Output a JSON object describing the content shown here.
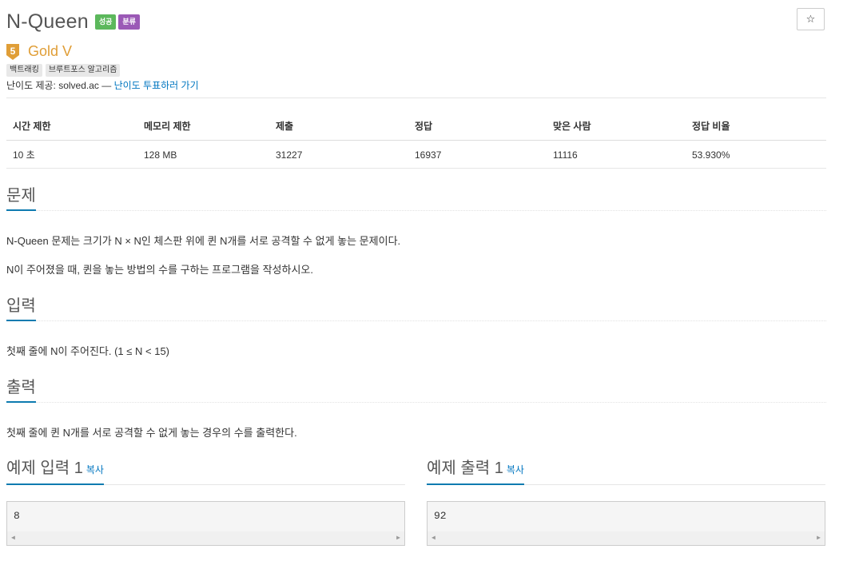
{
  "problem": {
    "title": "N-Queen",
    "badges": [
      "성공",
      "분류"
    ],
    "star": "☆",
    "tier_number": "5",
    "tier_name": "Gold V",
    "tags": [
      "백트래킹",
      "브루트포스 알고리즘"
    ],
    "provider_prefix": "난이도 제공: solved.ac — ",
    "provider_link": "난이도 투표하러 가기"
  },
  "info": {
    "headers": [
      "시간 제한",
      "메모리 제한",
      "제출",
      "정답",
      "맞은 사람",
      "정답 비율"
    ],
    "values": [
      "10 초",
      "128 MB",
      "31227",
      "16937",
      "11116",
      "53.930%"
    ]
  },
  "sections": {
    "problem_title": "문제",
    "problem_text": [
      "N-Queen 문제는 크기가 N × N인 체스판 위에 퀸 N개를 서로 공격할 수 없게 놓는 문제이다.",
      "N이 주어졌을 때, 퀸을 놓는 방법의 수를 구하는 프로그램을 작성하시오."
    ],
    "input_title": "입력",
    "input_text": "첫째 줄에 N이 주어진다. (1 ≤ N < 15)",
    "output_title": "출력",
    "output_text": "첫째 줄에 퀸 N개를 서로 공격할 수 없게 놓는 경우의 수를 출력한다."
  },
  "samples": {
    "input_title": "예제 입력 1",
    "output_title": "예제 출력 1",
    "copy_label": "복사",
    "input_value": "8",
    "output_value": "92"
  },
  "colors": {
    "success": "#5cb85c",
    "category": "#9b59b6",
    "gold": "#e09e37",
    "link": "#0076c0"
  }
}
